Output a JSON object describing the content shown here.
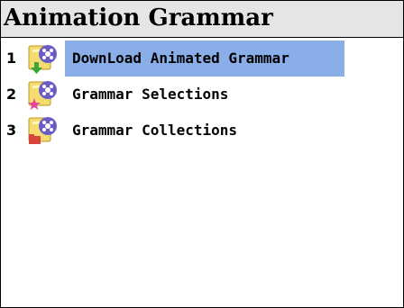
{
  "title": "Animation Grammar",
  "menu": {
    "items": [
      {
        "number": "1",
        "label": "DownLoad Animated Grammar",
        "icon": "film-download-icon",
        "selected": true
      },
      {
        "number": "2",
        "label": "Grammar Selections",
        "icon": "film-star-icon",
        "selected": false
      },
      {
        "number": "3",
        "label": "Grammar Collections",
        "icon": "film-folder-icon",
        "selected": false
      }
    ]
  },
  "colors": {
    "title_bar": "#e5e5e5",
    "selection": "#8aaee8",
    "icon_reel": "#6a5cc8",
    "icon_folder": "#f6dc6e",
    "download_arrow": "#3aa63a",
    "star": "#e8449a",
    "collection_tab": "#d8443a"
  }
}
